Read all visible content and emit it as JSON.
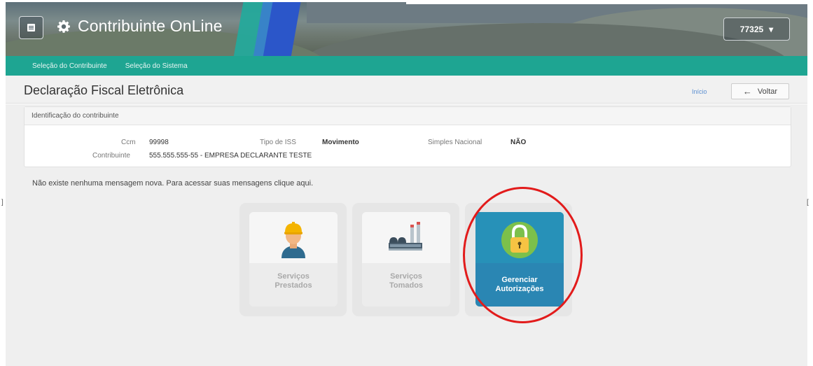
{
  "header": {
    "app_title": "Contribuinte OnLine",
    "menu_icon": "hamburger-menu-icon",
    "brand_icon": "gear-icon",
    "user_code": "77325",
    "user_caret": "▾"
  },
  "nav": {
    "items": [
      {
        "label": "Seleção do Contribuinte"
      },
      {
        "label": "Seleção do Sistema"
      }
    ]
  },
  "page": {
    "title": "Declaração Fiscal Eletrônica",
    "inicio_link": "Início",
    "back_label": "Voltar",
    "back_icon": "arrow-left-icon"
  },
  "taxpayer_panel": {
    "heading": "Identificação do contribuinte",
    "ccm_label": "Ccm",
    "ccm_value": "99998",
    "iss_label": "Tipo de ISS",
    "iss_value": "Movimento",
    "simples_label": "Simples Nacional",
    "simples_value": "NÃO",
    "contribuinte_label": "Contribuinte",
    "contribuinte_value": "555.555.555-55 - EMPRESA DECLARANTE TESTE"
  },
  "message": "Não existe nenhuma mensagem nova. Para acessar suas mensagens clique aqui.",
  "tiles": [
    {
      "line1": "Serviços",
      "line2": "Prestados",
      "icon": "worker-icon"
    },
    {
      "line1": "Serviços",
      "line2": "Tomados",
      "icon": "factory-icon"
    },
    {
      "line1": "Gerenciar",
      "line2": "Autorizações",
      "icon": "padlock-icon"
    }
  ],
  "colors": {
    "nav_teal": "#1ea592",
    "active_tile": "#2a86b3",
    "highlight_circle": "#e21b1b"
  }
}
